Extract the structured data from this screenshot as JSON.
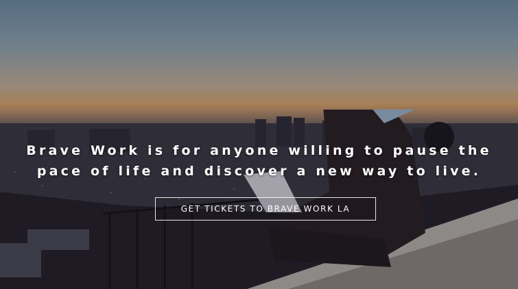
{
  "hero": {
    "headline_line1": "Brave Work is for anyone willing to pause the",
    "headline_line2": "pace of life and discover a new way to live.",
    "cta_label": "GET TICKETS TO BRAVE WORK LA"
  },
  "colors": {
    "text": "#ffffff",
    "sky_top": "#6f8fa8",
    "sunset": "#d9a66f"
  }
}
